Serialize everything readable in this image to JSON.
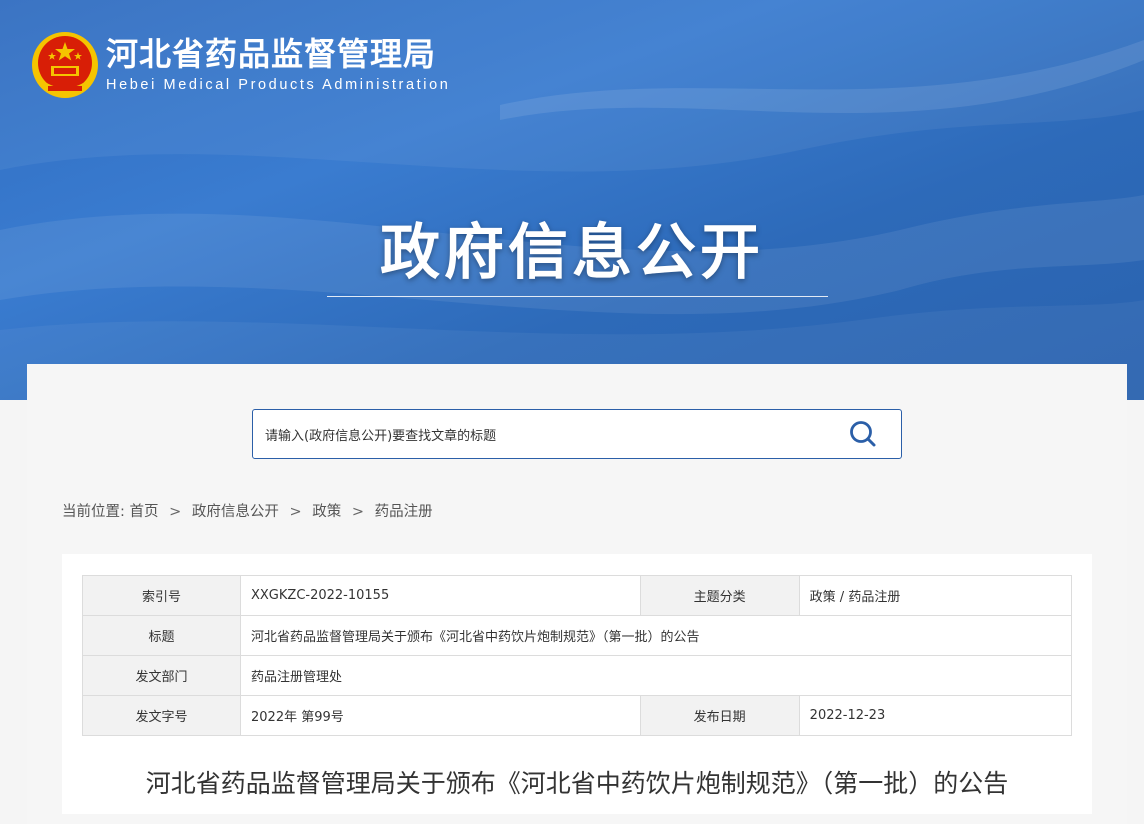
{
  "header": {
    "org_name_cn": "河北省药品监督管理局",
    "org_name_en": "Hebei Medical Products Administration",
    "section_title": "政府信息公开"
  },
  "search": {
    "placeholder": "请输入(政府信息公开)要查找文章的标题",
    "icon": "search-icon"
  },
  "breadcrumb": {
    "prefix": "当前位置:",
    "items": [
      "首页",
      "政府信息公开",
      "政策",
      "药品注册"
    ],
    "separator": ">"
  },
  "meta": {
    "index_label": "索引号",
    "index_value": "XXGKZC-2022-10155",
    "topic_label": "主题分类",
    "topic_value": "政策 / 药品注册",
    "title_label": "标题",
    "title_value": "河北省药品监督管理局关于颁布《河北省中药饮片炮制规范》（第一批）的公告",
    "dept_label": "发文部门",
    "dept_value": "药品注册管理处",
    "docno_label": "发文字号",
    "docno_value": "2022年 第99号",
    "date_label": "发布日期",
    "date_value": "2022-12-23"
  },
  "article": {
    "title": "河北省药品监督管理局关于颁布《河北省中药饮片炮制规范》（第一批）的公告"
  },
  "colors": {
    "banner_blue": "#2f6cc0",
    "search_border": "#2b5fa8",
    "emblem_red": "#d81e06",
    "emblem_gold": "#f5c400"
  }
}
